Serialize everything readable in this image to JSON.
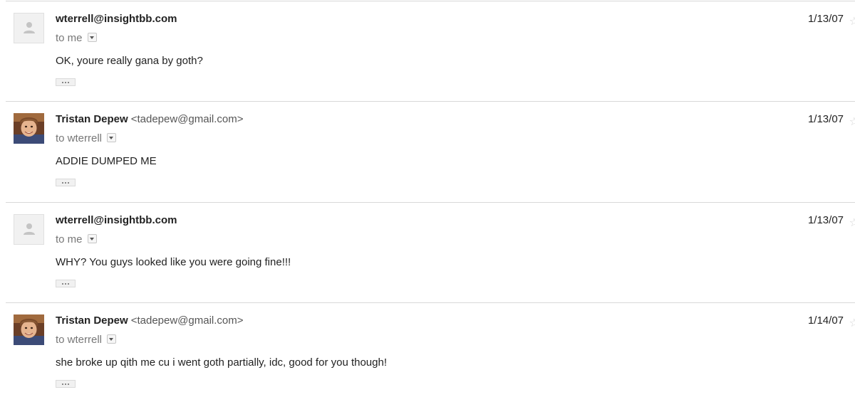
{
  "messages": [
    {
      "avatar": "default-avatar",
      "sender_name": "wterrell@insightbb.com",
      "sender_email": "",
      "recipient": "to me",
      "date": "1/13/07",
      "body": "OK, youre really gana by goth?"
    },
    {
      "avatar": "photo-avatar",
      "sender_name": "Tristan Depew",
      "sender_email": "<tadepew@gmail.com>",
      "recipient": "to wterrell",
      "date": "1/13/07",
      "body": "ADDIE DUMPED ME"
    },
    {
      "avatar": "default-avatar",
      "sender_name": "wterrell@insightbb.com",
      "sender_email": "",
      "recipient": "to me",
      "date": "1/13/07",
      "body": "WHY? You guys looked like you were going fine!!!"
    },
    {
      "avatar": "photo-avatar",
      "sender_name": "Tristan Depew",
      "sender_email": "<tadepew@gmail.com>",
      "recipient": "to wterrell",
      "date": "1/14/07",
      "body": "she broke up qith me cu i went goth partially, idc, good for you though!"
    }
  ],
  "icons": {
    "star": "star-icon",
    "dropdown": "chevron-down-icon",
    "ellipsis": "show-trimmed-content-icon",
    "placeholder": "person-icon"
  },
  "colors": {
    "divider": "#d8d8d8",
    "meta_text": "#777777",
    "body_text": "#222222"
  }
}
